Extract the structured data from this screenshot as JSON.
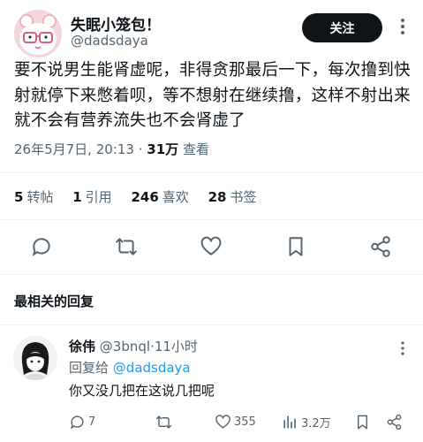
{
  "post": {
    "author_name": "失眠小笼包！",
    "author_handle": "@dadsdaya",
    "follow_label": "关注",
    "text": "要不说男生能肾虚呢，非得贪那最后一下，每次撸到快射就停下来憋着呗，等不想射在继续撸，这样不射出来就不会有营养流失也不会肾虚了",
    "timestamp": "26年5月7日, 20:13",
    "separator": "·",
    "views_count": "31万",
    "views_label": "查看",
    "stats": [
      {
        "count": "5",
        "label": "转帖"
      },
      {
        "count": "1",
        "label": "引用"
      },
      {
        "count": "246",
        "label": "喜欢"
      },
      {
        "count": "28",
        "label": "书签"
      }
    ],
    "actions": [
      "reply-icon",
      "retweet-icon",
      "heart-icon",
      "bookmark-icon",
      "share-icon"
    ]
  },
  "replies_section": {
    "title": "最相关的回复"
  },
  "reply": {
    "author_name": "徐伟",
    "author_handle": "@3bnql",
    "separator": "·",
    "time": "11小时",
    "reply_to_label": "回复给",
    "reply_to_handle": "@dadsdaya",
    "text": "你又没几把在这说几把呢",
    "reply_count": "7",
    "like_count": "355",
    "view_count": "3.2万"
  },
  "colors": {
    "text": "#0f1419",
    "secondary": "#536471",
    "link": "#1d9bf0",
    "divider": "#eff3f4",
    "button_bg": "#0f1419"
  }
}
